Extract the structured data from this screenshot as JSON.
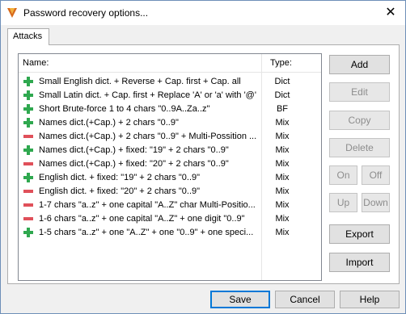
{
  "window": {
    "title": "Password recovery options...",
    "close_glyph": "✕"
  },
  "tabs": [
    {
      "label": "Attacks"
    }
  ],
  "list": {
    "columns": {
      "name": "Name:",
      "type": "Type:"
    },
    "rows": [
      {
        "name": "Small English dict. + Reverse + Cap. first + Cap. all",
        "type": "Dict",
        "icon": "plus-icon"
      },
      {
        "name": "Small Latin dict. + Cap. first + Replace 'A' or 'a' with '@'",
        "type": "Dict",
        "icon": "plus-icon"
      },
      {
        "name": "Short Brute-force 1 to 4 chars \"0..9A..Za..z\"",
        "type": "BF",
        "icon": "plus-icon"
      },
      {
        "name": "Names dict.(+Cap.) + 2 chars \"0..9\"",
        "type": "Mix",
        "icon": "plus-icon"
      },
      {
        "name": "Names dict.(+Cap.) + 2 chars \"0..9\" + Multi-Possition ...",
        "type": "Mix",
        "icon": "minus-icon"
      },
      {
        "name": "Names dict.(+Cap.) + fixed: \"19\" + 2 chars \"0..9\"",
        "type": "Mix",
        "icon": "plus-icon"
      },
      {
        "name": "Names dict.(+Cap.) + fixed: \"20\" + 2 chars \"0..9\"",
        "type": "Mix",
        "icon": "minus-icon"
      },
      {
        "name": "English dict. + fixed: \"19\" + 2 chars \"0..9\"",
        "type": "Mix",
        "icon": "plus-icon"
      },
      {
        "name": "English dict. + fixed: \"20\" + 2 chars \"0..9\"",
        "type": "Mix",
        "icon": "minus-icon"
      },
      {
        "name": "1-7 chars \"a..z\" + one capital \"A..Z\" char Multi-Positio...",
        "type": "Mix",
        "icon": "minus-icon"
      },
      {
        "name": "1-6 chars \"a..z\" + one capital \"A..Z\" + one digit \"0..9\"",
        "type": "Mix",
        "icon": "minus-icon"
      },
      {
        "name": "1-5 chars \"a..z\" + one \"A..Z\" + one \"0..9\" + one speci...",
        "type": "Mix",
        "icon": "plus-icon"
      }
    ]
  },
  "side_buttons": {
    "add": "Add",
    "edit": "Edit",
    "copy": "Copy",
    "delete": "Delete",
    "on": "On",
    "off": "Off",
    "up": "Up",
    "down": "Down",
    "export": "Export",
    "import": "Import"
  },
  "bottom_buttons": {
    "save": "Save",
    "cancel": "Cancel",
    "help": "Help"
  },
  "colors": {
    "plus": "#2fa84f",
    "minus": "#e0505a",
    "accent": "#0078d7"
  }
}
